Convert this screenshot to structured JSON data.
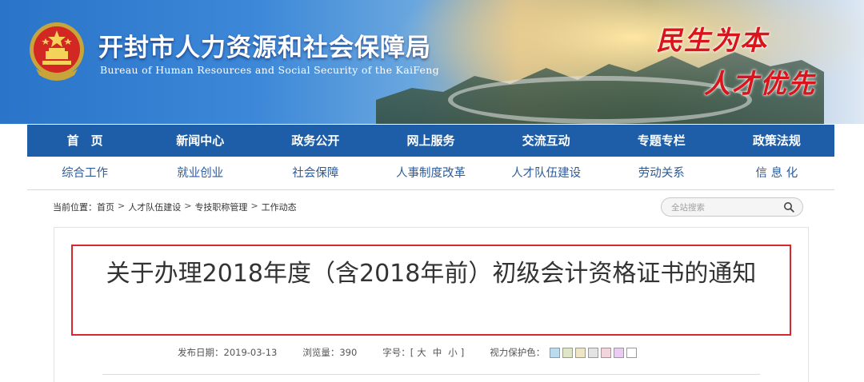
{
  "header": {
    "title": "开封市人力资源和社会保障局",
    "subtitle": "Bureau of Human Resources and Social Security of the KaiFeng",
    "slogan_line1": "民生为本",
    "slogan_line2": "人才优先"
  },
  "nav_main": [
    "首　页",
    "新闻中心",
    "政务公开",
    "网上服务",
    "交流互动",
    "专题专栏",
    "政策法规"
  ],
  "nav_sub": [
    "综合工作",
    "就业创业",
    "社会保障",
    "人事制度改革",
    "人才队伍建设",
    "劳动关系",
    "信 息 化"
  ],
  "breadcrumb": {
    "prefix": "当前位置：",
    "items": [
      "首页",
      "人才队伍建设",
      "专技职称管理",
      "工作动态"
    ],
    "separator": ">"
  },
  "search": {
    "placeholder": "全站搜索"
  },
  "article": {
    "title": "关于办理2018年度（含2018年前）初级会计资格证书的通知",
    "publish_label": "发布日期：",
    "publish_date": "2019-03-13",
    "views_label": "浏览量：",
    "views": "390",
    "font_label": "字号：[",
    "font_large": "大",
    "font_medium": "中",
    "font_small": "小",
    "font_end": "]",
    "eye_label": "视力保护色："
  },
  "colors": {
    "nav_main_bg": "#1e5ea8",
    "title_border": "#d7282f",
    "swatches": [
      "#b9dcf0",
      "#dfe6c8",
      "#eee5c6",
      "#e3e3e3",
      "#f2d4dc",
      "#e7cdf0",
      "#ffffff"
    ]
  }
}
